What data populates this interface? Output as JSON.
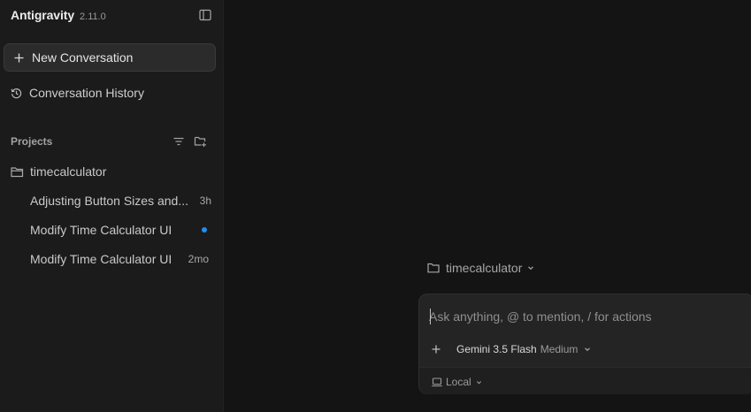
{
  "app": {
    "name": "Antigravity",
    "version": "2.11.0"
  },
  "sidebar": {
    "new_conversation": "New Conversation",
    "conversation_history": "Conversation History",
    "projects_label": "Projects",
    "project": {
      "name": "timecalculator"
    },
    "conversations": [
      {
        "title": "Adjusting Button Sizes and...",
        "time": "3h"
      },
      {
        "title": "Modify Time Calculator UI",
        "time": "",
        "active_dot": true
      },
      {
        "title": "Modify Time Calculator UI",
        "time": "2mo"
      }
    ]
  },
  "main": {
    "workspace": "timecalculator",
    "composer": {
      "placeholder": "Ask anything, @ to mention, / for actions",
      "model_name": "Gemini 3.5 Flash",
      "model_mode": "Medium",
      "environment": "Local"
    }
  },
  "icons": {
    "panel_toggle": "sidebar-panel-icon",
    "new": "plus-icon",
    "history": "history-icon",
    "filter": "filter-icon",
    "new_folder": "folder-plus-icon",
    "folder": "folder-icon",
    "laptop": "laptop-icon"
  },
  "colors": {
    "accent_dot": "#1f8ef1",
    "background": "#141414",
    "sidebar": "#1b1b1b"
  }
}
